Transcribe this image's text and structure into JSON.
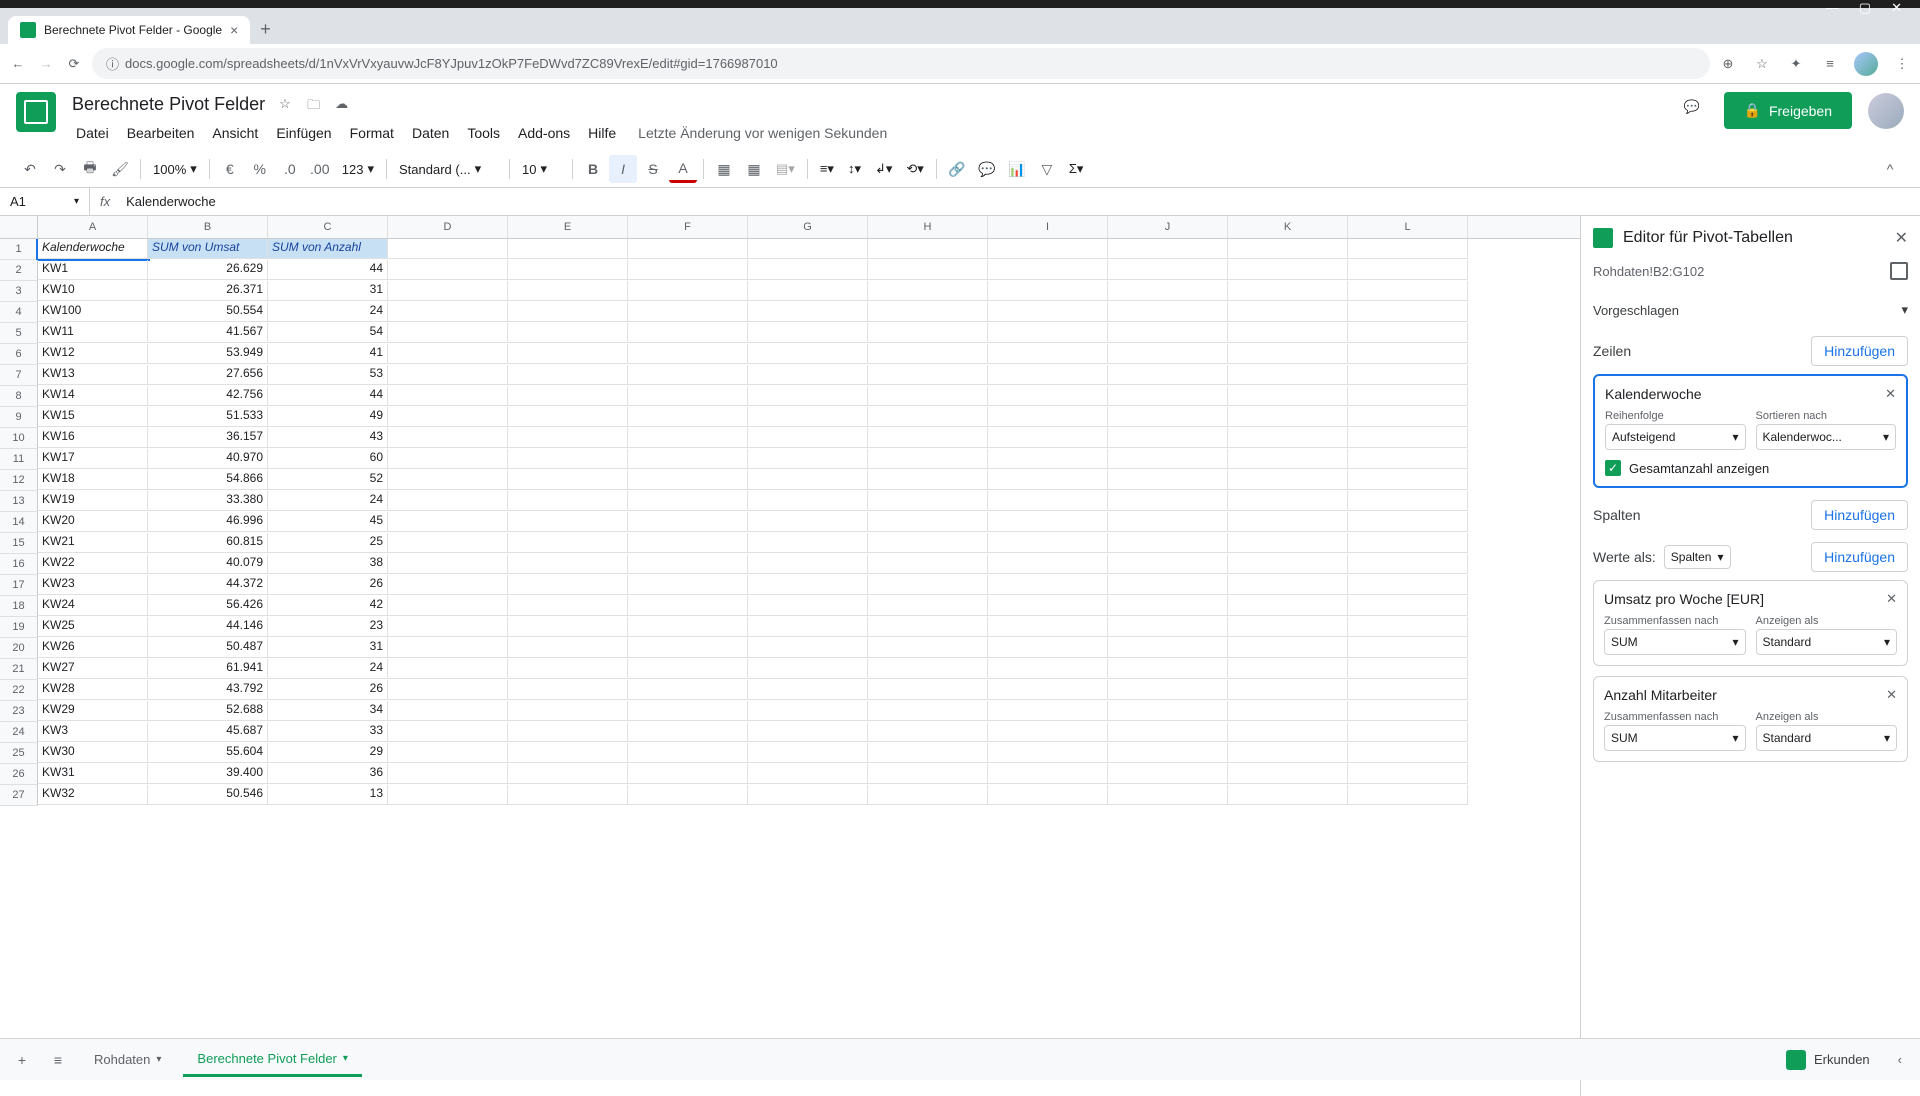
{
  "browser": {
    "tab_title": "Berechnete Pivot Felder - Google",
    "url": "docs.google.com/spreadsheets/d/1nVxVrVxyauvwJcF8YJpuv1zOkP7FeDWvd7ZC89VrexE/edit#gid=1766987010"
  },
  "doc": {
    "title": "Berechnete Pivot Felder",
    "last_edit": "Letzte Änderung vor wenigen Sekunden"
  },
  "menu": {
    "file": "Datei",
    "edit": "Bearbeiten",
    "view": "Ansicht",
    "insert": "Einfügen",
    "format": "Format",
    "data": "Daten",
    "tools": "Tools",
    "addons": "Add-ons",
    "help": "Hilfe"
  },
  "share": {
    "label": "Freigeben"
  },
  "toolbar": {
    "zoom": "100%",
    "font": "Standard (...",
    "size": "10",
    "formula": "123"
  },
  "namebox": "A1",
  "formula_value": "Kalenderwoche",
  "columns": [
    "A",
    "B",
    "C",
    "D",
    "E",
    "F",
    "G",
    "H",
    "I",
    "J",
    "K",
    "L"
  ],
  "headers": {
    "a": "Kalenderwoche",
    "b": "SUM von Umsat",
    "c": "SUM von Anzahl"
  },
  "rows": [
    {
      "n": 1
    },
    {
      "n": 2,
      "a": "KW1",
      "b": "26.629",
      "c": "44"
    },
    {
      "n": 3,
      "a": "KW10",
      "b": "26.371",
      "c": "31"
    },
    {
      "n": 4,
      "a": "KW100",
      "b": "50.554",
      "c": "24"
    },
    {
      "n": 5,
      "a": "KW11",
      "b": "41.567",
      "c": "54"
    },
    {
      "n": 6,
      "a": "KW12",
      "b": "53.949",
      "c": "41"
    },
    {
      "n": 7,
      "a": "KW13",
      "b": "27.656",
      "c": "53"
    },
    {
      "n": 8,
      "a": "KW14",
      "b": "42.756",
      "c": "44"
    },
    {
      "n": 9,
      "a": "KW15",
      "b": "51.533",
      "c": "49"
    },
    {
      "n": 10,
      "a": "KW16",
      "b": "36.157",
      "c": "43"
    },
    {
      "n": 11,
      "a": "KW17",
      "b": "40.970",
      "c": "60"
    },
    {
      "n": 12,
      "a": "KW18",
      "b": "54.866",
      "c": "52"
    },
    {
      "n": 13,
      "a": "KW19",
      "b": "33.380",
      "c": "24"
    },
    {
      "n": 14,
      "a": "KW20",
      "b": "46.996",
      "c": "45"
    },
    {
      "n": 15,
      "a": "KW21",
      "b": "60.815",
      "c": "25"
    },
    {
      "n": 16,
      "a": "KW22",
      "b": "40.079",
      "c": "38"
    },
    {
      "n": 17,
      "a": "KW23",
      "b": "44.372",
      "c": "26"
    },
    {
      "n": 18,
      "a": "KW24",
      "b": "56.426",
      "c": "42"
    },
    {
      "n": 19,
      "a": "KW25",
      "b": "44.146",
      "c": "23"
    },
    {
      "n": 20,
      "a": "KW26",
      "b": "50.487",
      "c": "31"
    },
    {
      "n": 21,
      "a": "KW27",
      "b": "61.941",
      "c": "24"
    },
    {
      "n": 22,
      "a": "KW28",
      "b": "43.792",
      "c": "26"
    },
    {
      "n": 23,
      "a": "KW29",
      "b": "52.688",
      "c": "34"
    },
    {
      "n": 24,
      "a": "KW3",
      "b": "45.687",
      "c": "33"
    },
    {
      "n": 25,
      "a": "KW30",
      "b": "55.604",
      "c": "29"
    },
    {
      "n": 26,
      "a": "KW31",
      "b": "39.400",
      "c": "36"
    },
    {
      "n": 27,
      "a": "KW32",
      "b": "50.546",
      "c": "13"
    }
  ],
  "pivot": {
    "title": "Editor für Pivot-Tabellen",
    "range": "Rohdaten!B2:G102",
    "suggested": "Vorgeschlagen",
    "rows_label": "Zeilen",
    "cols_label": "Spalten",
    "values_label": "Werte als:",
    "add": "Hinzufügen",
    "values_as": "Spalten",
    "row_field": {
      "name": "Kalenderwoche",
      "order_label": "Reihenfolge",
      "order_value": "Aufsteigend",
      "sortby_label": "Sortieren nach",
      "sortby_value": "Kalenderwoc...",
      "show_totals": "Gesamtanzahl anzeigen"
    },
    "value1": {
      "name": "Umsatz pro Woche [EUR]",
      "summarize_label": "Zusammenfassen nach",
      "summarize_value": "SUM",
      "showas_label": "Anzeigen als",
      "showas_value": "Standard"
    },
    "value2": {
      "name": "Anzahl Mitarbeiter",
      "summarize_label": "Zusammenfassen nach",
      "summarize_value": "SUM",
      "showas_label": "Anzeigen als",
      "showas_value": "Standard"
    }
  },
  "tabs": {
    "raw": "Rohdaten",
    "pivot": "Berechnete Pivot Felder"
  },
  "explore": "Erkunden"
}
